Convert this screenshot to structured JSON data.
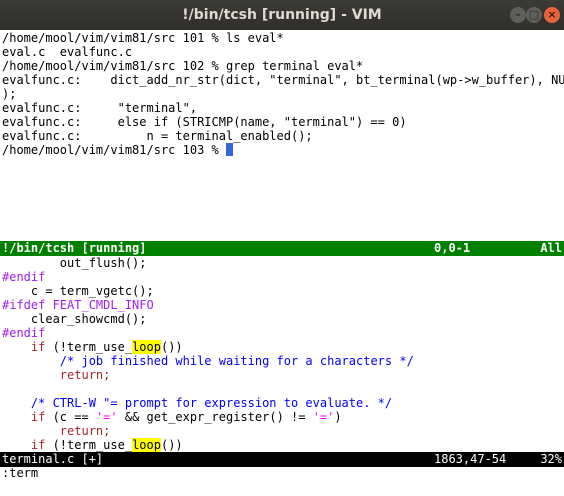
{
  "window": {
    "title": "!/bin/tcsh [running] - VIM",
    "minimize_glyph": "–",
    "maximize_glyph": "□",
    "close_glyph": "×"
  },
  "terminal": {
    "lines": [
      "/home/mool/vim/vim81/src 101 % ls eval*",
      "eval.c  evalfunc.c",
      "/home/mool/vim/vim81/src 102 % grep terminal eval*",
      "evalfunc.c:    dict_add_nr_str(dict, \"terminal\", bt_terminal(wp->w_buffer), NULL",
      ");",
      "evalfunc.c:     \"terminal\",",
      "evalfunc.c:     else if (STRICMP(name, \"terminal\") == 0)",
      "evalfunc.c:         n = terminal_enabled();"
    ],
    "prompt": "/home/mool/vim/vim81/src 103 % "
  },
  "term_status": {
    "name": "!/bin/tcsh [running]",
    "position": "0,0-1",
    "percent": "All"
  },
  "code": {
    "l0": "        out_flush();",
    "l1": "#endif",
    "l2": "    c = term_vgetc();",
    "l3": "#ifdef FEAT_CMDL_INFO",
    "l4": "    clear_showcmd();",
    "l5": "#endif",
    "l6a": "    ",
    "kw_if": "if",
    "l6b": " (!term_use_",
    "loop": "loop",
    "l6c": "())",
    "l7": "        /* job finished while waiting for a characters */",
    "l8": "        return;",
    "l10": "    /* CTRL-W \"= prompt for expression to evaluate. */",
    "l11a": " (c == ",
    "l11s1": "'='",
    "l11b": " && get_expr_register() != ",
    "l11s2": "'='",
    "l11c": ")",
    "l12": "        return;",
    "l13b": " (!term_use_",
    "l13c": "())"
  },
  "file_status": {
    "name": "terminal.c [+]",
    "position": "1863,47-54",
    "percent": "32%"
  },
  "cmdline": ":term"
}
